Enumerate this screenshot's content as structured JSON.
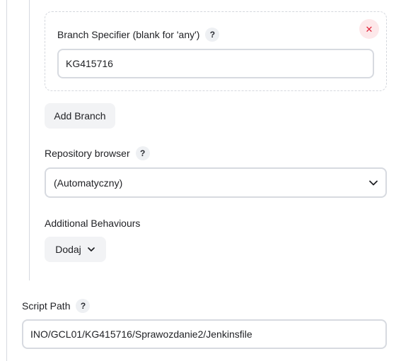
{
  "branch": {
    "specifier_label": "Branch Specifier (blank for 'any')",
    "specifier_value": "KG415716",
    "help_label": "?",
    "remove_icon": "close-icon",
    "remove_glyph": "✕"
  },
  "add_branch_label": "Add Branch",
  "repository_browser": {
    "label": "Repository browser",
    "help_label": "?",
    "selected": "(Automatyczny)",
    "icon": "chevron-down-icon"
  },
  "additional_behaviours": {
    "label": "Additional Behaviours",
    "button_label": "Dodaj",
    "icon": "chevron-down-icon"
  },
  "script_path": {
    "label": "Script Path",
    "help_label": "?",
    "value": "INO/GCL01/KG415716/Sprawozdanie2/Jenkinsfile"
  },
  "colors": {
    "close_icon": "#e0243a",
    "close_bg": "#fde8ea",
    "border": "#d7dae0",
    "button_bg": "#f2f3f5"
  }
}
